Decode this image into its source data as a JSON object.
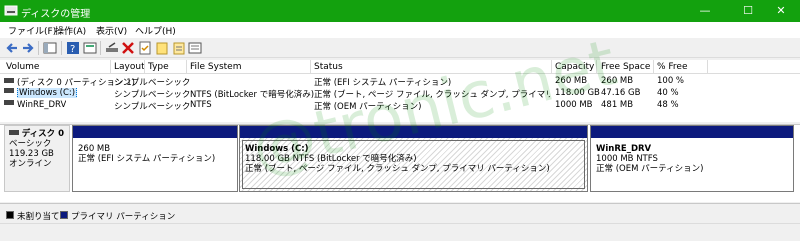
{
  "window": {
    "title": "ディスクの管理",
    "min": "—",
    "max": "☐",
    "close": "✕"
  },
  "menu": [
    "ファイル(F)",
    "操作(A)",
    "表示(V)",
    "ヘルプ(H)"
  ],
  "columns": [
    "Volume",
    "Layout",
    "Type",
    "File System",
    "Status",
    "Capacity",
    "Free Space",
    "% Free"
  ],
  "volumes": [
    {
      "volume": "(ディスク 0 パーティション 1)",
      "layout": "シンプル",
      "type": "ベーシック",
      "fs": "",
      "status": "正常 (EFI システム パーティション)",
      "capacity": "260 MB",
      "free": "260 MB",
      "pct": "100 %"
    },
    {
      "volume": "Windows (C:)",
      "layout": "シンプル",
      "type": "ベーシック",
      "fs": "NTFS (BitLocker で暗号化済み)",
      "status": "正常 (ブート, ページ ファイル, クラッシュ ダンプ, プライマリ パーティション)",
      "capacity": "118.00 GB",
      "free": "47.16 GB",
      "pct": "40 %"
    },
    {
      "volume": "WinRE_DRV",
      "layout": "シンプル",
      "type": "ベーシック",
      "fs": "NTFS",
      "status": "正常 (OEM パーティション)",
      "capacity": "1000 MB",
      "free": "481 MB",
      "pct": "48 %"
    }
  ],
  "disk": {
    "name": "ディスク 0",
    "type": "ベーシック",
    "size": "119.23 GB",
    "state": "オンライン",
    "partitions": [
      {
        "title": "",
        "size": "260 MB",
        "status": "正常 (EFI システム パーティション)"
      },
      {
        "title": "Windows  (C:)",
        "size": "118.00 GB NTFS (BitLocker で暗号化済み)",
        "status": "正常 (ブート, ページ ファイル, クラッシュ ダンプ, プライマリ パーティション)"
      },
      {
        "title": "WinRE_DRV",
        "size": "1000 MB NTFS",
        "status": "正常 (OEM パーティション)"
      }
    ]
  },
  "legend": [
    {
      "label": "未割り当て",
      "color": "#000000"
    },
    {
      "label": "プライマリ パーティション",
      "color": "#0c1a7d"
    }
  ],
  "watermark": "@tronic.net"
}
